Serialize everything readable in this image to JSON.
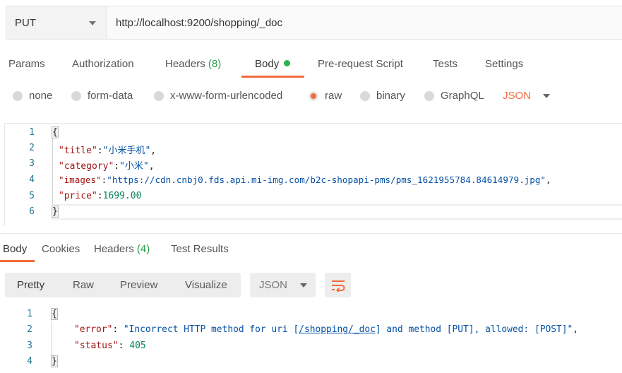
{
  "request": {
    "method": "PUT",
    "url": "http://localhost:9200/shopping/_doc"
  },
  "request_tabs": [
    {
      "label": "Params"
    },
    {
      "label": "Authorization"
    },
    {
      "label": "Headers",
      "count": "(8)"
    },
    {
      "label": "Body",
      "active": true
    },
    {
      "label": "Pre-request Script"
    },
    {
      "label": "Tests"
    },
    {
      "label": "Settings"
    }
  ],
  "body_types": [
    {
      "label": "none"
    },
    {
      "label": "form-data"
    },
    {
      "label": "x-www-form-urlencoded"
    },
    {
      "label": "raw",
      "selected": true
    },
    {
      "label": "binary"
    },
    {
      "label": "GraphQL"
    }
  ],
  "body_format": "JSON",
  "request_body": {
    "line_numbers": [
      "1",
      "2",
      "3",
      "4",
      "5",
      "6"
    ],
    "open": "{",
    "close": "}",
    "fields": [
      {
        "key": "\"title\"",
        "value": "\"小米手机\"",
        "trail": ","
      },
      {
        "key": "\"category\"",
        "value": "\"小米\"",
        "trail": ","
      },
      {
        "key": "\"images\"",
        "value": "\"https://cdn.cnbj0.fds.api.mi-img.com/b2c-shopapi-pms/pms_1621955784.84614979.jpg\"",
        "trail": ","
      },
      {
        "key": "\"price\"",
        "value": "1699.00",
        "trail": ""
      }
    ]
  },
  "response_tabs": [
    {
      "label": "Body",
      "active": true
    },
    {
      "label": "Cookies"
    },
    {
      "label": "Headers",
      "count": "(4)"
    },
    {
      "label": "Test Results"
    }
  ],
  "view_modes": [
    "Pretty",
    "Raw",
    "Preview",
    "Visualize"
  ],
  "response_format": "JSON",
  "wrap_icon": "wrap-lines-icon",
  "response_body": {
    "line_numbers": [
      "1",
      "2",
      "3",
      "4"
    ],
    "open": "{",
    "close": "}",
    "error_key": "\"error\"",
    "error_pre": "\"Incorrect HTTP method for uri [",
    "error_link": "/shopping/_doc",
    "error_post": "] and method [PUT], allowed: [POST]\"",
    "status_key": "\"status\"",
    "status_value": "405"
  },
  "colors": {
    "accent": "#f26b3a",
    "dot": "#2bb44a"
  }
}
